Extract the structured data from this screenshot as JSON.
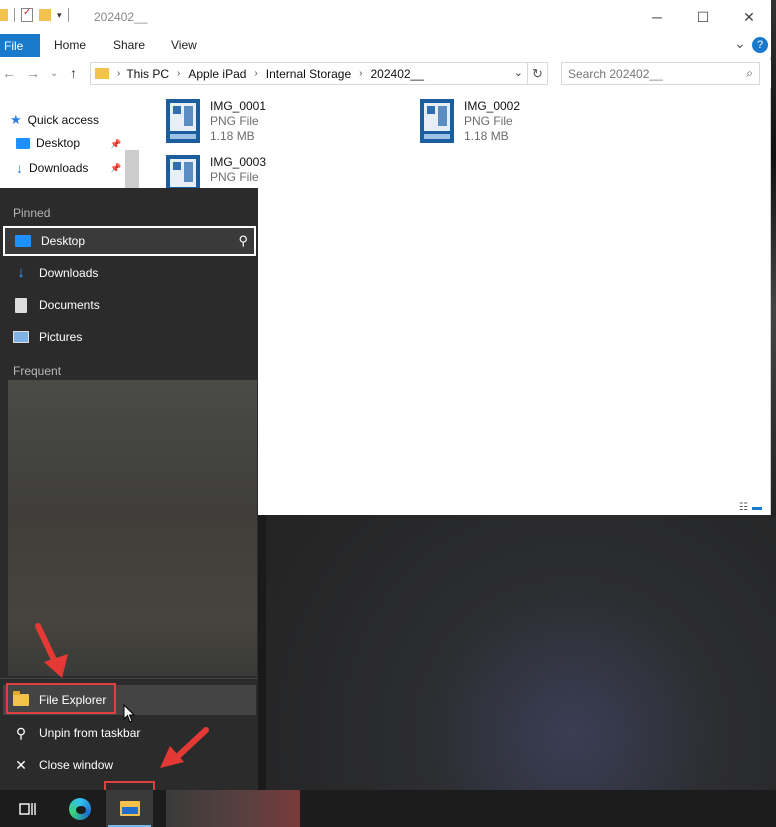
{
  "window": {
    "title": "202402__",
    "minimize": "─",
    "maximize": "☐",
    "close": "✕"
  },
  "ribbon": {
    "file_tab": "File",
    "tabs": [
      "Home",
      "Share",
      "View"
    ],
    "expand": "⌄",
    "help": "?"
  },
  "address": {
    "back": "←",
    "forward": "→",
    "recent": "⌄",
    "up": "↑",
    "breadcrumbs": [
      "This PC",
      "Apple iPad",
      "Internal Storage",
      "202402__"
    ],
    "dropdown": "⌄",
    "refresh": "↻",
    "search_placeholder": "Search 202402__",
    "search_glyph": "⌕"
  },
  "navpane": {
    "items": [
      {
        "label": "Quick access",
        "icon": "star-icon"
      },
      {
        "label": "Desktop",
        "icon": "desktop-icon"
      },
      {
        "label": "Downloads",
        "icon": "downloads-icon"
      }
    ]
  },
  "files": [
    {
      "name": "IMG_0001",
      "type": "PNG File",
      "size": "1.18 MB"
    },
    {
      "name": "IMG_0002",
      "type": "PNG File",
      "size": "1.18 MB"
    },
    {
      "name": "IMG_0003",
      "type": "PNG File"
    }
  ],
  "jumplist": {
    "pinned_header": "Pinned",
    "pinned": [
      {
        "label": "Desktop",
        "icon": "desktop-icon"
      },
      {
        "label": "Downloads",
        "icon": "downloads-icon"
      },
      {
        "label": "Documents",
        "icon": "documents-icon"
      },
      {
        "label": "Pictures",
        "icon": "pictures-icon"
      }
    ],
    "frequent_header": "Frequent",
    "actions": [
      {
        "label": "File Explorer",
        "icon": "folder-icon"
      },
      {
        "label": "Unpin from taskbar",
        "icon": "unpin-icon"
      },
      {
        "label": "Close window",
        "icon": "close-icon"
      }
    ]
  },
  "taskbar": {
    "task_view": "task-view-icon",
    "edge": "edge-icon",
    "explorer": "file-explorer-icon"
  },
  "colors": {
    "accent": "#1979ca",
    "highlight": "#e04040",
    "jumplist_bg": "#2b2b2b",
    "taskbar_bg": "#1c1c1c"
  }
}
